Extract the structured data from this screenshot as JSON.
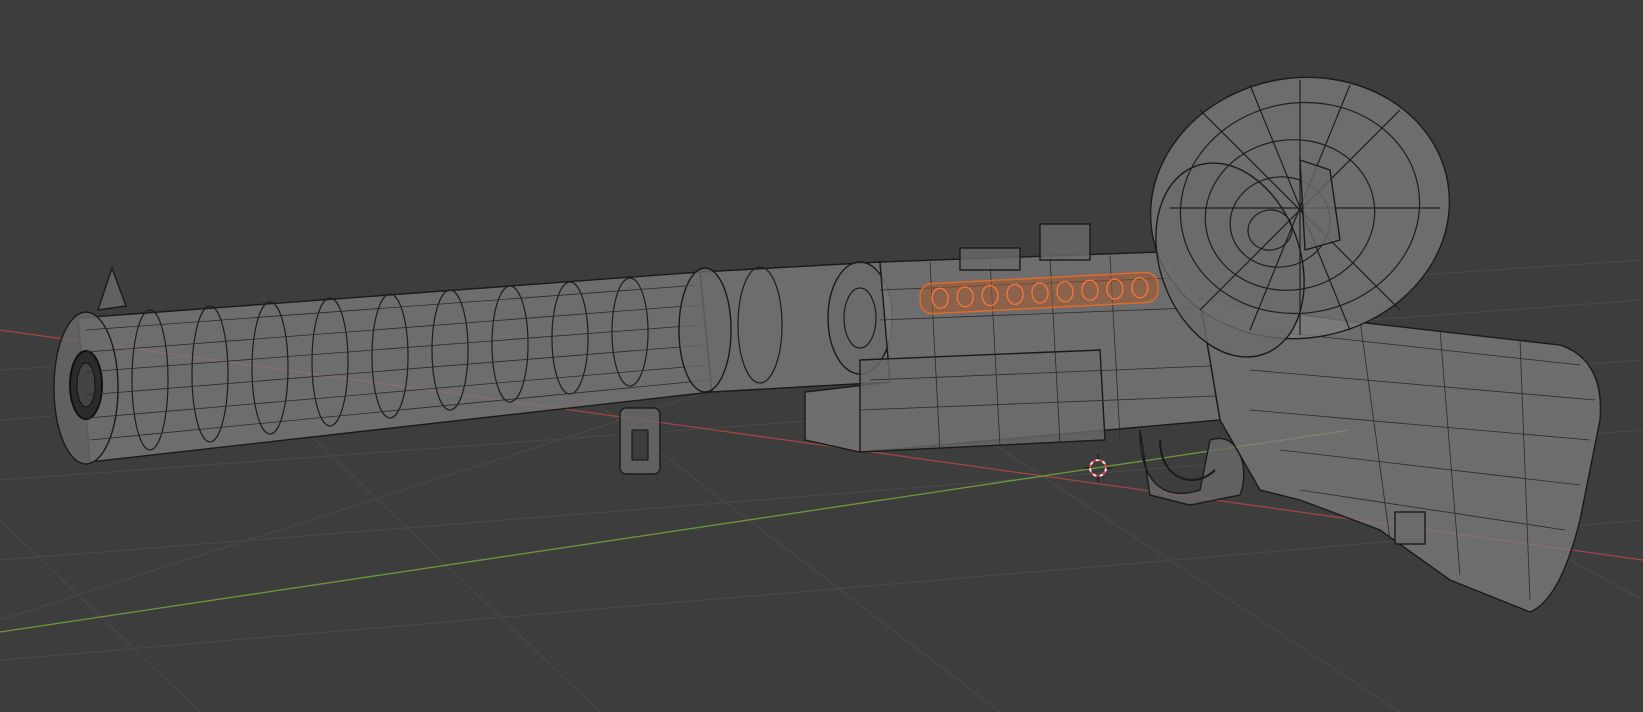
{
  "viewport": {
    "mode": "edit-mode-wireframe",
    "background_color": "#3d3d3d",
    "grid_color": "#4a4a4a",
    "x_axis_color": "#a04444",
    "y_axis_color": "#6c9a3a",
    "selection_color": "#e06a2a"
  },
  "scene": {
    "object": "rifle-mesh",
    "parts": [
      "suppressor-barrel",
      "receiver",
      "front-sight",
      "rear-sight",
      "drum-magazine",
      "trigger-guard",
      "stock",
      "bipod-mount",
      "sling-mount"
    ],
    "cursor_icon": "3d-cursor-icon"
  }
}
